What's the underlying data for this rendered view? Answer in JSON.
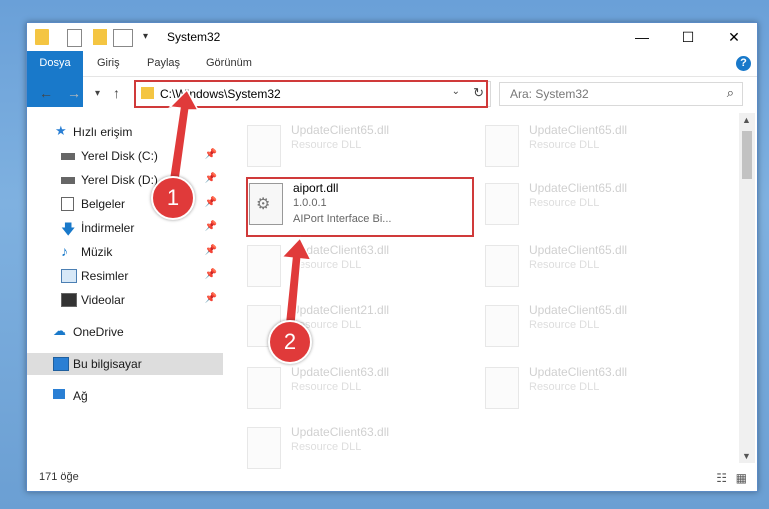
{
  "window": {
    "title": "System32"
  },
  "ribbon": {
    "tabs": [
      "Dosya",
      "Giriş",
      "Paylaş",
      "Görünüm"
    ],
    "help": "?"
  },
  "nav": {
    "address": "C:\\Windows\\System32",
    "search_placeholder": "Ara: System32"
  },
  "sidebar": {
    "items": [
      {
        "label": "Hızlı erişim",
        "icon": "star-icon"
      },
      {
        "label": "Yerel Disk (C:)",
        "icon": "drive-icon",
        "pinned": true
      },
      {
        "label": "Yerel Disk (D:)",
        "icon": "drive-icon",
        "pinned": true
      },
      {
        "label": "Belgeler",
        "icon": "documents-icon",
        "pinned": true
      },
      {
        "label": "İndirmeler",
        "icon": "download-icon",
        "pinned": true
      },
      {
        "label": "Müzik",
        "icon": "music-icon",
        "pinned": true
      },
      {
        "label": "Resimler",
        "icon": "pictures-icon",
        "pinned": true
      },
      {
        "label": "Videolar",
        "icon": "video-icon",
        "pinned": true
      },
      {
        "label": "OneDrive",
        "icon": "cloud-icon"
      },
      {
        "label": "Bu bilgisayar",
        "icon": "computer-icon",
        "selected": true
      },
      {
        "label": "Ağ",
        "icon": "network-icon"
      }
    ]
  },
  "files": {
    "highlighted": {
      "name": "aiport.dll",
      "version": "1.0.0.1",
      "description": "AIPort Interface Bi..."
    },
    "faded": [
      {
        "name": "UpdateClient65.dll",
        "type": "Resource DLL"
      },
      {
        "name": "UpdateClient65.dll",
        "type": "Resource DLL"
      },
      {
        "name": "UpdateClient65.dll",
        "type": "Resource DLL"
      },
      {
        "name": "UpdateClient63.dll",
        "type": "Resource DLL"
      },
      {
        "name": "UpdateClient65.dll",
        "type": "Resource DLL"
      },
      {
        "name": "UpdateClient63.dll",
        "type": "Resource DLL"
      },
      {
        "name": "UpdateClient21.dll",
        "type": "Resource DLL"
      },
      {
        "name": "UpdateClient65.dll",
        "type": "Resource DLL"
      },
      {
        "name": "UpdateClient63.dll",
        "type": "Resource DLL"
      },
      {
        "name": "UpdateClient63.dll",
        "type": "Resource DLL"
      }
    ]
  },
  "status": {
    "count": "171 öğe"
  },
  "annotations": {
    "step1": "1",
    "step2": "2",
    "highlight_color": "#d03a3a"
  }
}
